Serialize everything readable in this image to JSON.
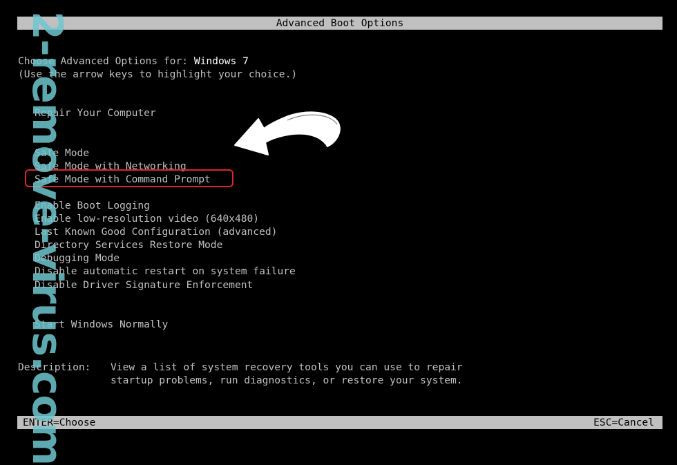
{
  "header": {
    "title": "Advanced Boot Options"
  },
  "intro": {
    "line1": "Choose Advanced Options for: ",
    "os_name": "Windows 7",
    "line2": "(Use the arrow keys to highlight your choice.)"
  },
  "menu": {
    "items": [
      "Repair Your Computer",
      "Safe Mode",
      "Safe Mode with Networking",
      "Safe Mode with Command Prompt",
      "Enable Boot Logging",
      "Enable low-resolution video (640x480)",
      "Last Known Good Configuration (advanced)",
      "Directory Services Restore Mode",
      "Debugging Mode",
      "Disable automatic restart on system failure",
      "Disable Driver Signature Enforcement",
      "Start Windows Normally"
    ],
    "highlighted_item": "Safe Mode with Command Prompt"
  },
  "description": {
    "label": "Description:",
    "line1": "View a list of system recovery tools you can use to repair",
    "line2": "startup problems, run diagnostics, or restore your system."
  },
  "footer": {
    "left": "ENTER=Choose",
    "right": "ESC=Cancel"
  },
  "watermark": {
    "text": "2-remove-virus.com"
  },
  "colors": {
    "background": "#000000",
    "text": "#c0c0c0",
    "bar": "#c0c0c0",
    "highlight_border": "#d9262b",
    "watermark": "#6fc7cf"
  }
}
